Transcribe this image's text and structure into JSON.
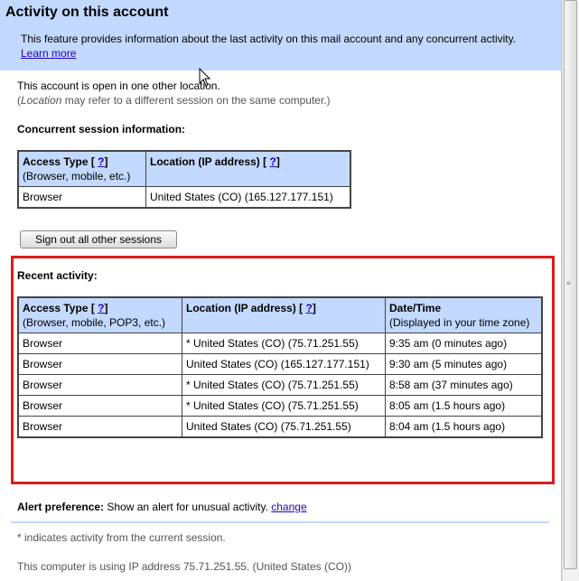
{
  "title": "Activity on this account",
  "intro": {
    "text": "This feature provides information about the last activity on this mail account and any concurrent activity.",
    "link": "Learn more"
  },
  "status": {
    "line1": "This account is open in one other location.",
    "line2_em": "Location",
    "line2_rest": " may refer to a different session on the same computer.)"
  },
  "concurrent": {
    "heading": "Concurrent session information:",
    "headers": {
      "access_title": "Access Type [",
      "access_help": "?",
      "access_close": "]",
      "access_sub": "(Browser, mobile, etc.)",
      "location_title": "Location (IP address) [",
      "location_help": "?",
      "location_close": "]"
    },
    "rows": [
      {
        "access": "Browser",
        "location": "United States (CO) (165.127.177.151)"
      }
    ]
  },
  "signout_button": "Sign out all other sessions",
  "recent": {
    "heading": "Recent activity:",
    "headers": {
      "access_title": "Access Type [",
      "access_help": "?",
      "access_close": "]",
      "access_sub": "(Browser, mobile, POP3, etc.)",
      "location_title": "Location (IP address) [",
      "location_help": "?",
      "location_close": "]",
      "date_title": "Date/Time",
      "date_sub": "(Displayed in your time zone)"
    },
    "rows": [
      {
        "access": "Browser",
        "location": "* United States (CO) (75.71.251.55)",
        "date": "9:35 am (0 minutes ago)"
      },
      {
        "access": "Browser",
        "location": "United States (CO) (165.127.177.151)",
        "date": "9:30 am (5 minutes ago)"
      },
      {
        "access": "Browser",
        "location": "* United States (CO) (75.71.251.55)",
        "date": "8:58 am (37 minutes ago)"
      },
      {
        "access": "Browser",
        "location": "* United States (CO) (75.71.251.55)",
        "date": "8:05 am (1.5 hours ago)"
      },
      {
        "access": "Browser",
        "location": "United States (CO) (75.71.251.55)",
        "date": "8:04 am (1.5 hours ago)"
      }
    ]
  },
  "alert": {
    "label": "Alert preference:",
    "text": " Show an alert for unusual activity. ",
    "link": "change"
  },
  "footnote": "* indicates activity from the current session.",
  "ip_note": "This computer is using IP address 75.71.251.55. (United States (CO))",
  "icons": {
    "cursor": "mouse-pointer-icon",
    "grip": "scrollbar-grip-icon"
  },
  "colors": {
    "header_bg": "#c3d9ff",
    "highlight_border": "#dd1b1b",
    "link": "#2200cc"
  }
}
